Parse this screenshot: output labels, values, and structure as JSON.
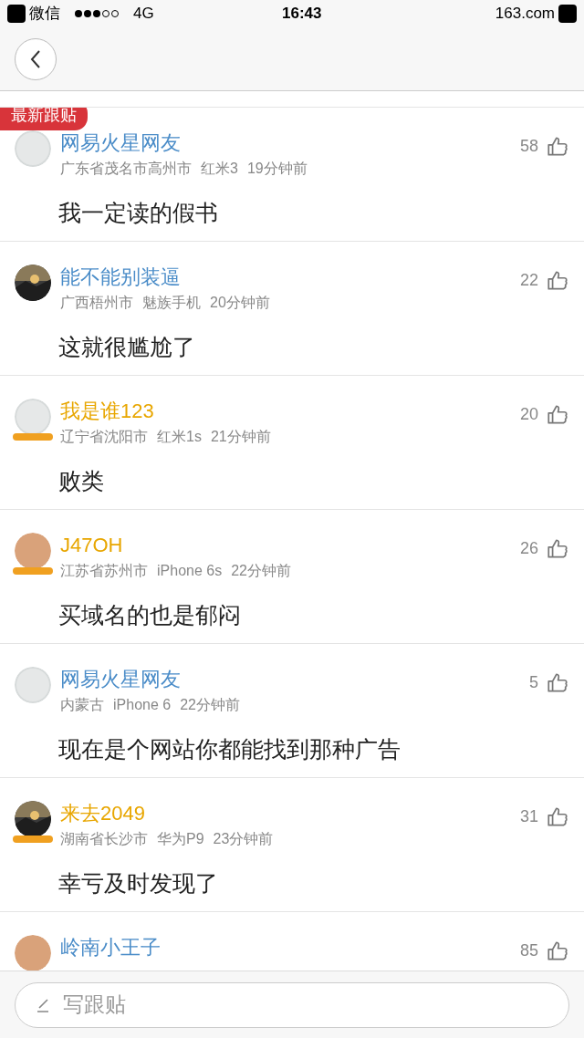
{
  "status_bar": {
    "back_app": "微信",
    "carrier": "4G",
    "time": "16:43",
    "site": "163.com"
  },
  "section_badge": "最新跟贴",
  "comments": [
    {
      "user": "网易火星网友",
      "vip": false,
      "avatar": {
        "kind": "default"
      },
      "location": "广东省茂名市高州市",
      "device": "红米3",
      "time": "19分钟前",
      "likes": "58",
      "text": "我一定读的假书"
    },
    {
      "user": "能不能别装逼",
      "vip": false,
      "location": "广西梧州市",
      "device": "魅族手机",
      "time": "20分钟前",
      "likes": "22",
      "text": "这就很尴尬了"
    },
    {
      "user": "我是谁123",
      "vip": true,
      "avatar": {
        "kind": "default"
      },
      "location": "辽宁省沈阳市",
      "device": "红米1s",
      "time": "21分钟前",
      "likes": "20",
      "text": "败类"
    },
    {
      "user": "J47OH",
      "vip": true,
      "avatar": {
        "kind": "tan"
      },
      "location": "江苏省苏州市",
      "device": "iPhone 6s",
      "time": "22分钟前",
      "likes": "26",
      "text": "买域名的也是郁闷"
    },
    {
      "user": "网易火星网友",
      "vip": false,
      "avatar": {
        "kind": "default"
      },
      "location": "内蒙古",
      "device": "iPhone 6",
      "time": "22分钟前",
      "likes": "5",
      "text": "现在是个网站你都能找到那种广告"
    },
    {
      "user": "来去2049",
      "vip": true,
      "location": "湖南省长沙市",
      "device": "华为P9",
      "time": "23分钟前",
      "likes": "31",
      "text": "幸亏及时发现了"
    },
    {
      "user": "岭南小王子",
      "vip": false,
      "avatar": {
        "kind": "tan"
      },
      "likes": "85"
    }
  ],
  "reply_field": {
    "placeholder": "写跟贴"
  }
}
